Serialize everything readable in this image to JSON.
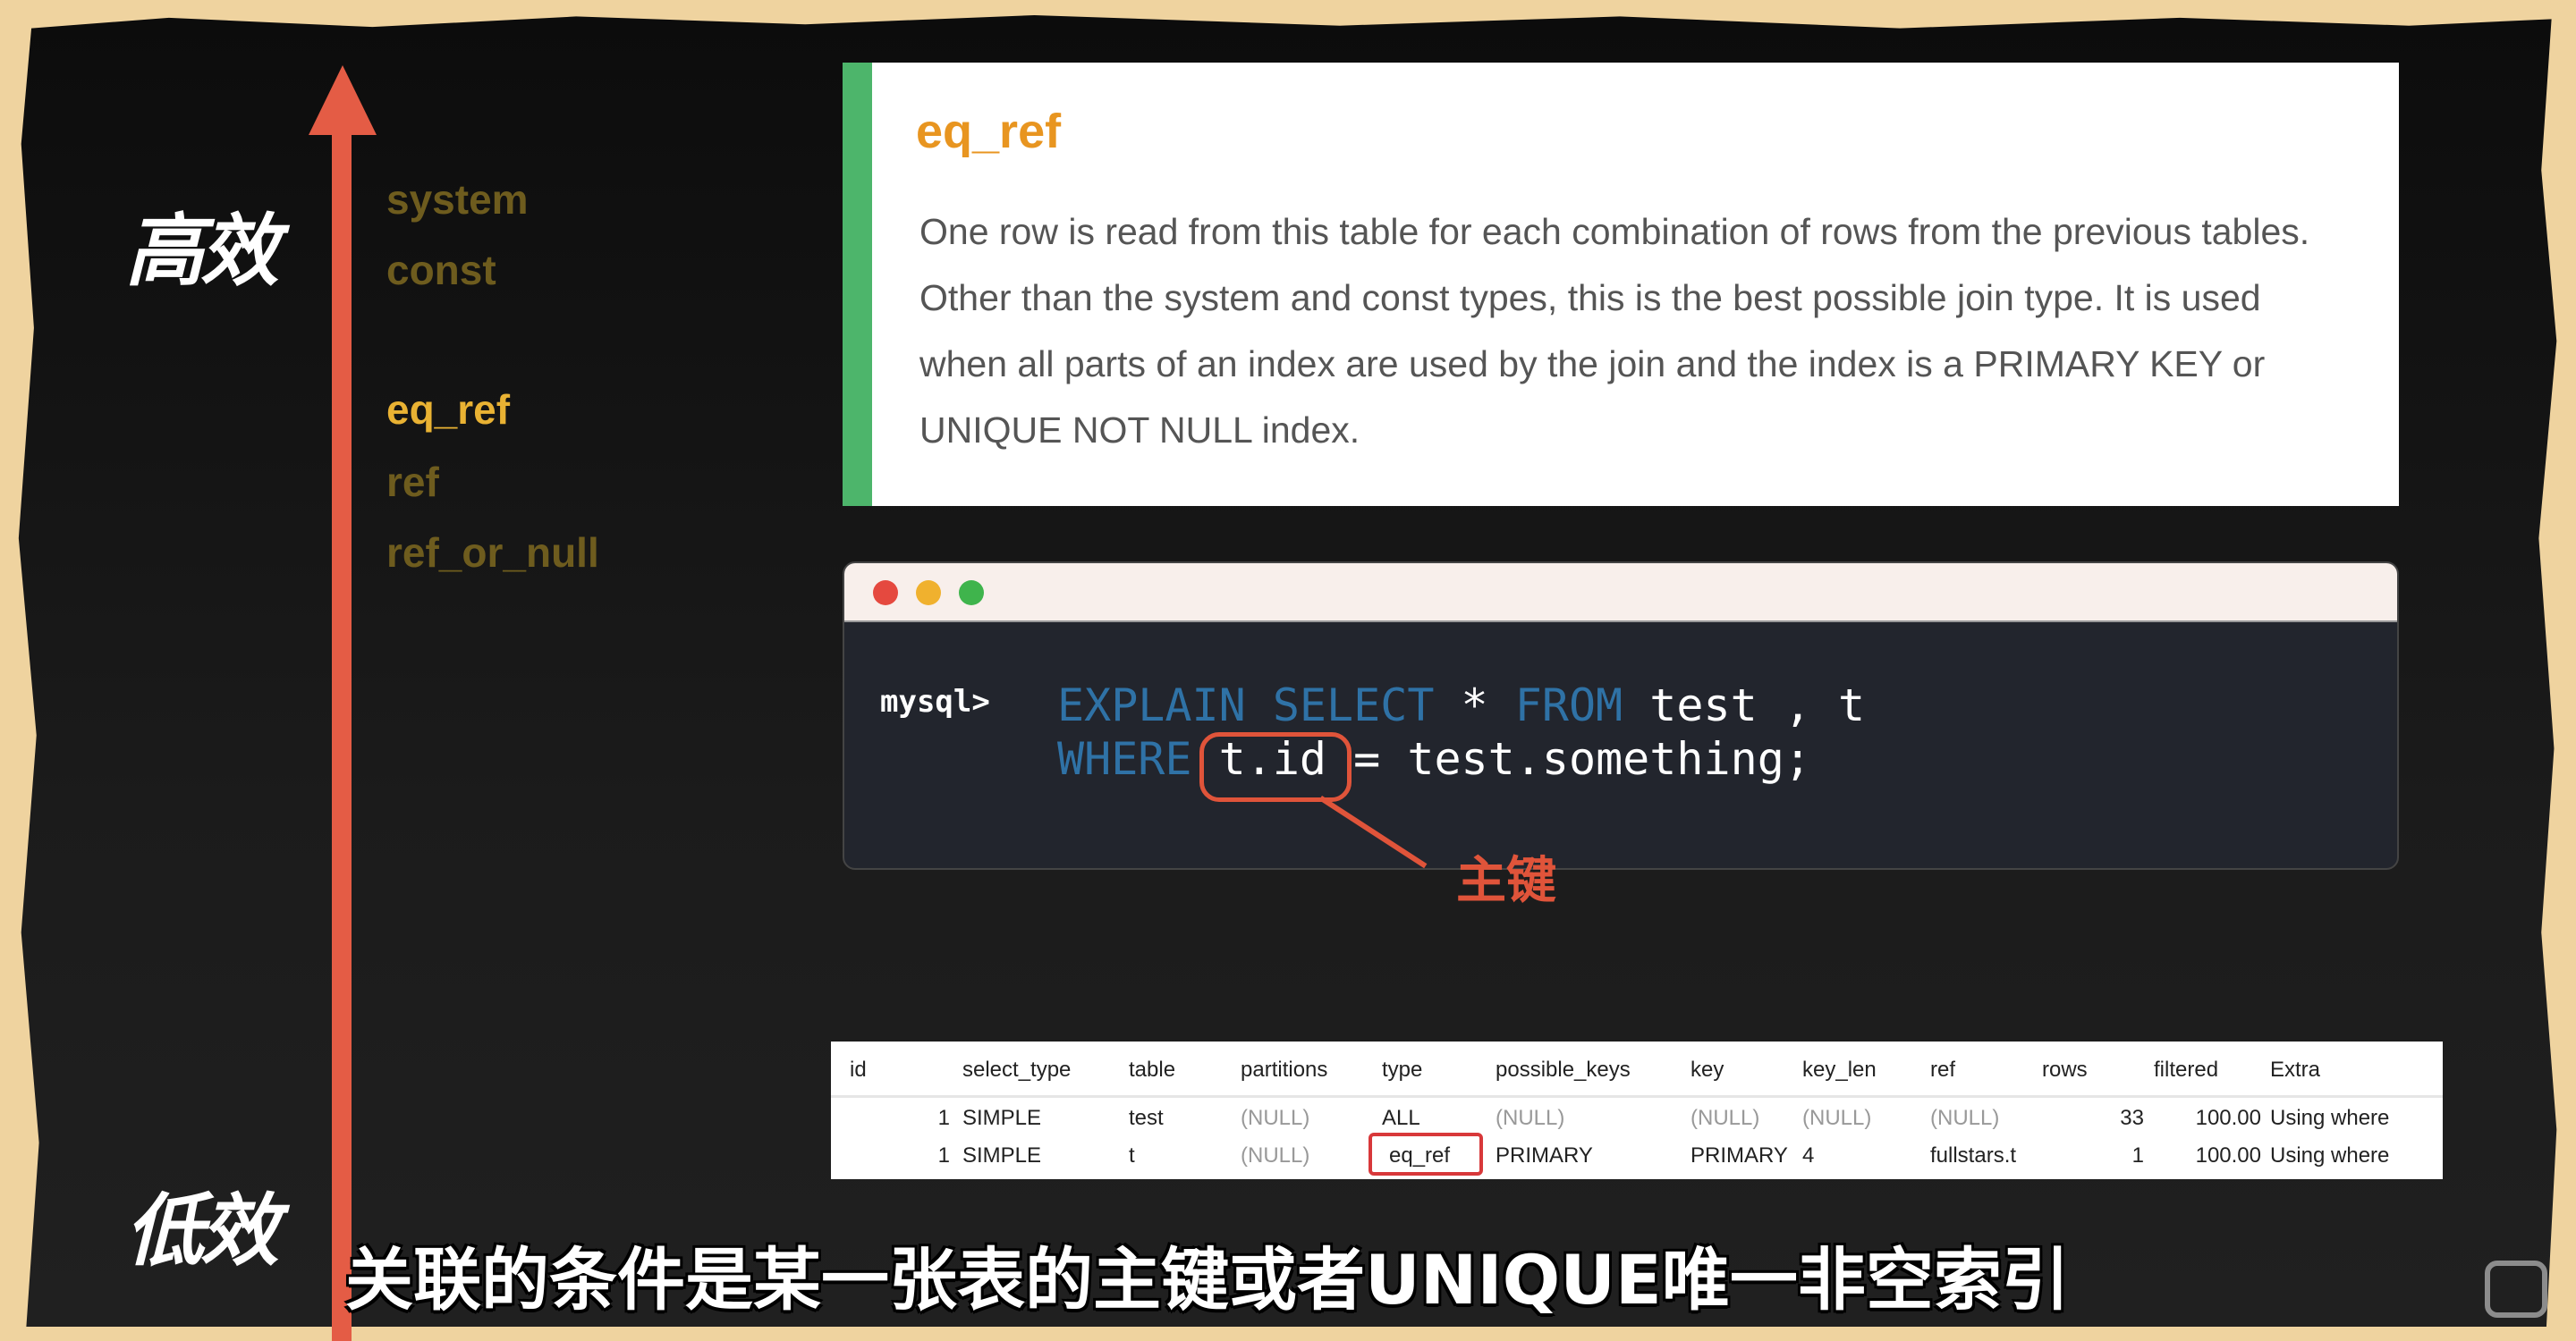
{
  "scale": {
    "high": "高效",
    "low": "低效"
  },
  "types": [
    "system",
    "const",
    "eq_ref",
    "ref",
    "ref_or_null"
  ],
  "active_type": "eq_ref",
  "doc_card": {
    "title": "eq_ref",
    "text": "One row is read from this table for each combination of rows from the previous tables. Other than the system and const types, this is the best possible join type. It is used when all parts of an index are used by the join and the index is a PRIMARY KEY or UNIQUE NOT NULL index."
  },
  "terminal": {
    "prompt": "mysql>",
    "line1": {
      "kw1": "EXPLAIN SELECT",
      "op": " * ",
      "kw2": "FROM",
      "rest": " test , t"
    },
    "line2": {
      "kw": "WHERE",
      "highlight": "t.id",
      "rest": " = test.something;"
    },
    "annotation": "主键"
  },
  "result_table": {
    "columns": [
      "id",
      "select_type",
      "table",
      "partitions",
      "type",
      "possible_keys",
      "key",
      "key_len",
      "ref",
      "rows",
      "filtered",
      "Extra"
    ],
    "rows": [
      [
        "1",
        "SIMPLE",
        "test",
        "(NULL)",
        "ALL",
        "(NULL)",
        "(NULL)",
        "(NULL)",
        "(NULL)",
        "33",
        "100.00",
        "Using where"
      ],
      [
        "1",
        "SIMPLE",
        "t",
        "(NULL)",
        "eq_ref",
        "PRIMARY",
        "PRIMARY",
        "4",
        "fullstars.t",
        "1",
        "100.00",
        "Using where"
      ]
    ]
  },
  "subtitle": "关联的条件是某一张表的主键或者UNIQUE唯一非空索引",
  "colors": {
    "arrow": "#e45c45",
    "active": "#e9b233",
    "dim": "#6e5c1e",
    "card_bar": "#4db56b",
    "keyword": "#2f72a6",
    "annotation": "#e0543a"
  }
}
